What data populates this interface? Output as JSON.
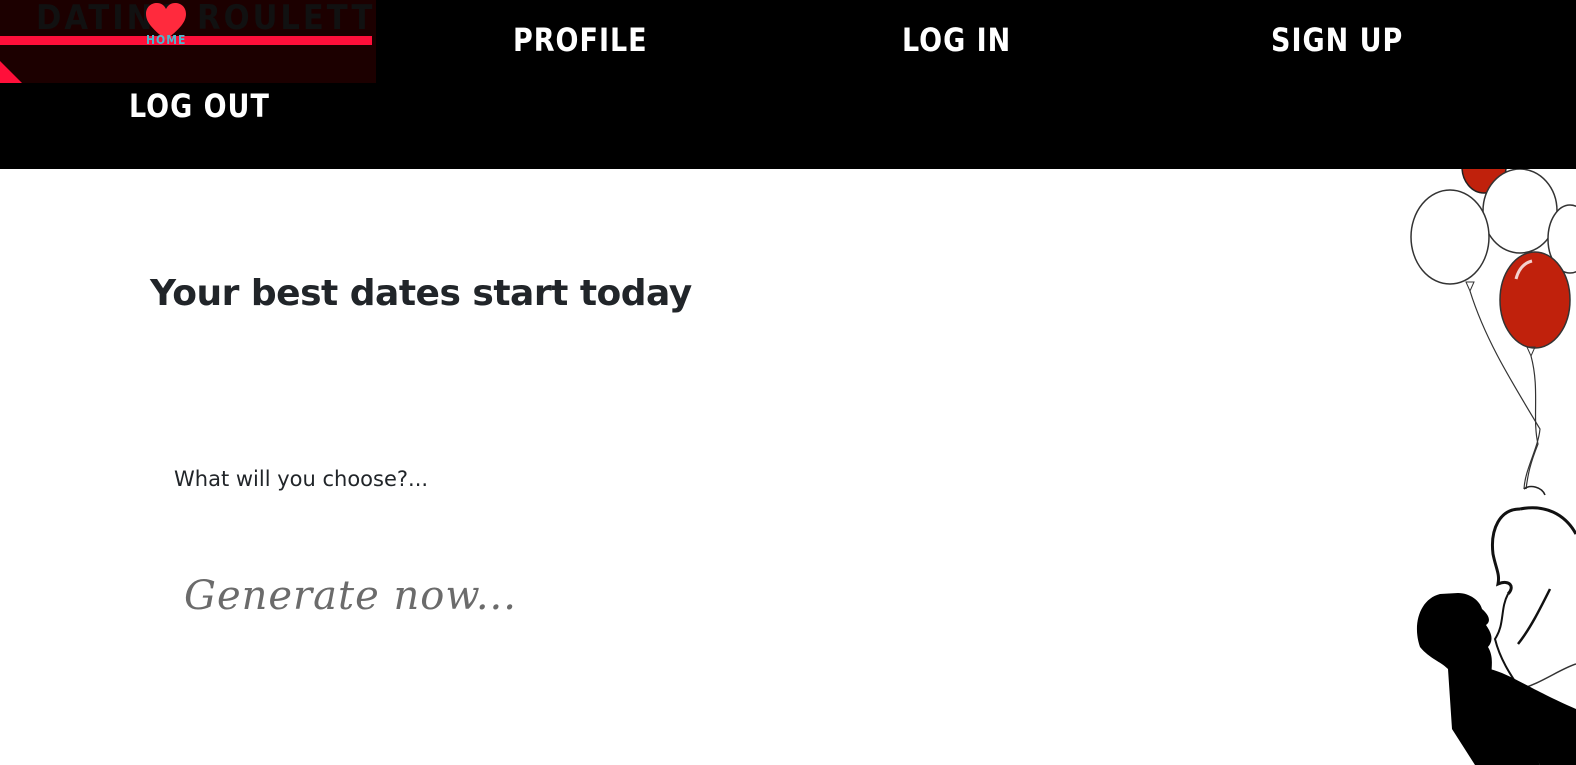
{
  "brand": {
    "name": "DATING ROULETTE",
    "home_label": "HOME",
    "colors": {
      "stripe": "#ff0f3a",
      "heart": "#ff2a3d",
      "home": "#4cb8cf"
    }
  },
  "nav": {
    "profile": "PROFILE",
    "login": "LOG IN",
    "signup": "SIGN UP",
    "logout": "LOG OUT"
  },
  "hero": {
    "title": "Your best dates start today",
    "prompt": "What will you choose?...",
    "generate": "Generate now..."
  },
  "illustration": {
    "icon": "couple-with-balloons-illustration",
    "balloon_red": "#c0210c"
  }
}
